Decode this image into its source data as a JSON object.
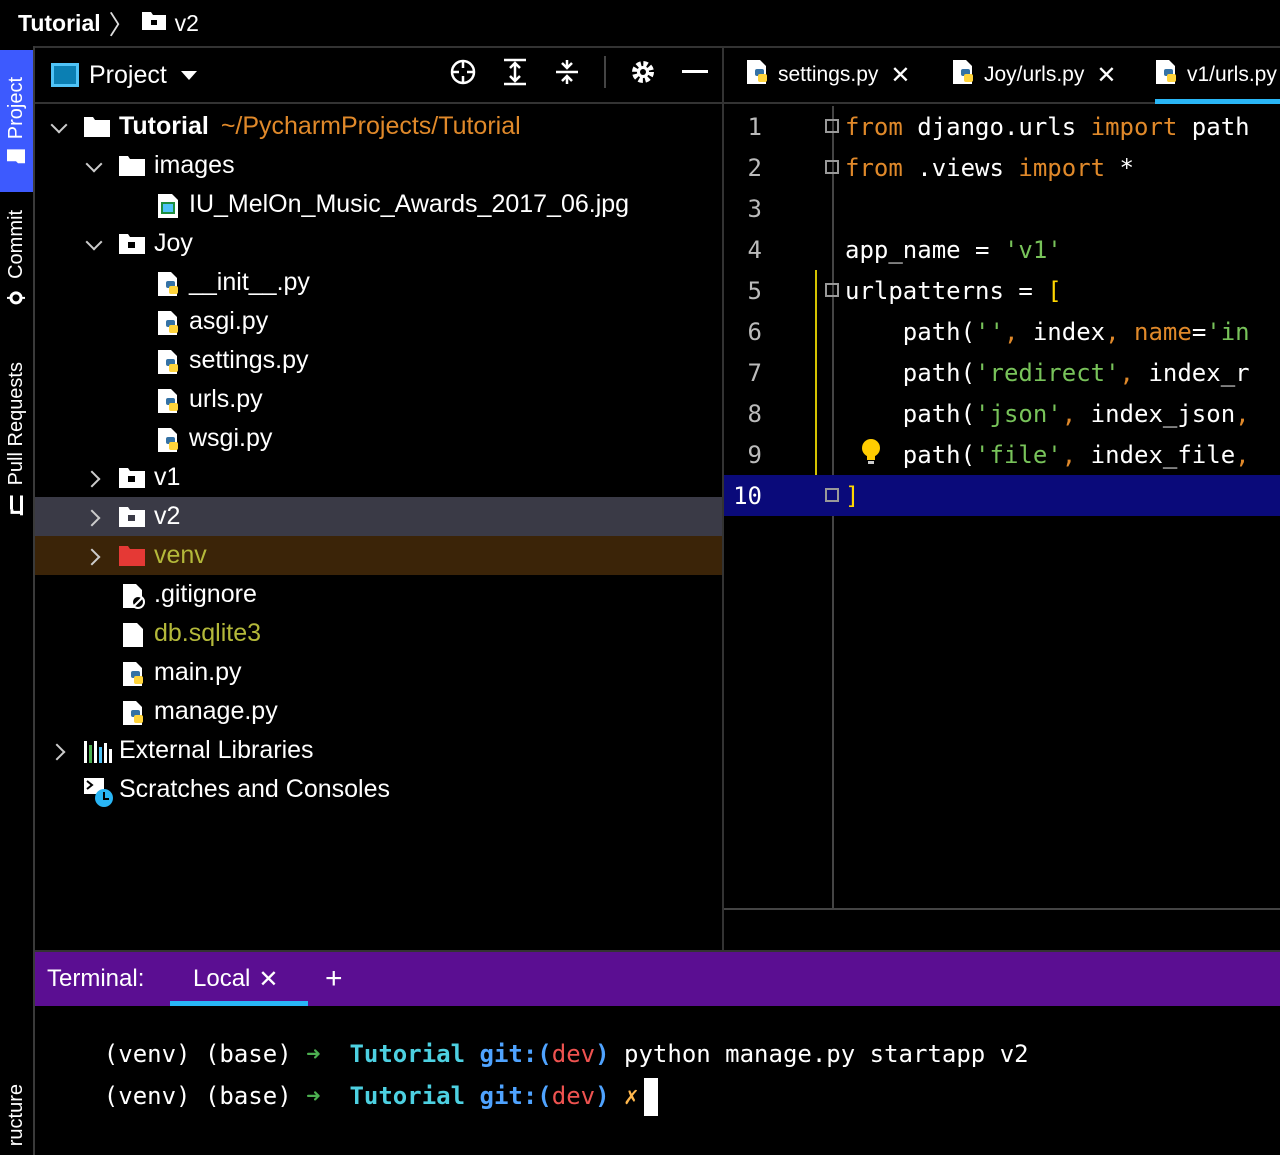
{
  "breadcrumb": {
    "root": "Tutorial",
    "current": "v2"
  },
  "toolstrip": {
    "project": "Project",
    "commit": "Commit",
    "pull_requests": "Pull Requests",
    "structure": "ructure"
  },
  "project_panel": {
    "title": "Project",
    "tree": {
      "root_name": "Tutorial",
      "root_path": "~/PycharmProjects/Tutorial",
      "images": "images",
      "image_file": "IU_MelOn_Music_Awards_2017_06.jpg",
      "joy": "Joy",
      "joy_files": [
        "__init__.py",
        "asgi.py",
        "settings.py",
        "urls.py",
        "wsgi.py"
      ],
      "v1": "v1",
      "v2": "v2",
      "venv": "venv",
      "gitignore": ".gitignore",
      "db": "db.sqlite3",
      "main": "main.py",
      "manage": "manage.py",
      "external": "External Libraries",
      "scratches": "Scratches and Consoles"
    }
  },
  "editor": {
    "tabs": [
      "settings.py",
      "Joy/urls.py",
      "v1/urls.py"
    ],
    "line_numbers": [
      "1",
      "2",
      "3",
      "4",
      "5",
      "6",
      "7",
      "8",
      "9",
      "10"
    ],
    "current_line": 10
  },
  "terminal": {
    "title": "Terminal:",
    "tab": "Local",
    "prompt_env": "(venv) (base)",
    "arrow": "➜",
    "dir": "Tutorial",
    "git": "git:(",
    "branch": "dev",
    "git_close": ")",
    "command": "python manage.py startapp v2",
    "dirty": "✗"
  },
  "colors": {
    "accent": "#3d5afe",
    "tab_underline": "#29b6f6",
    "terminal_header": "#5b0e92",
    "current_line": "#0a0a7a"
  }
}
